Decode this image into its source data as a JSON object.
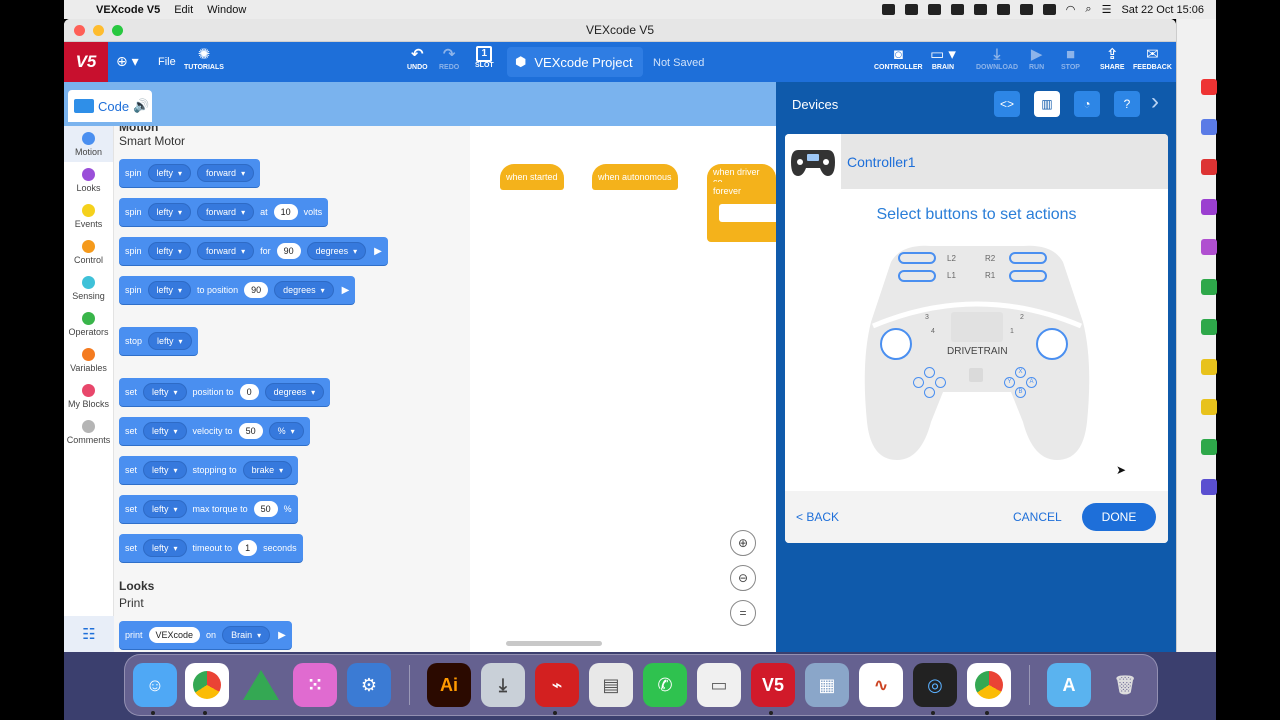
{
  "menubar": {
    "app_name": "VEXcode V5",
    "items": [
      "Edit",
      "Window"
    ],
    "clock": "Sat 22 Oct  15:06"
  },
  "window": {
    "title": "VEXcode V5"
  },
  "toolbar": {
    "logo": "V5",
    "file_label": "File",
    "tutorials_label": "TUTORIALS",
    "undo_label": "UNDO",
    "redo_label": "REDO",
    "slot_label": "SLOT",
    "slot_number": "1",
    "project_name": "VEXcode Project",
    "save_status": "Not Saved",
    "controller_label": "CONTROLLER",
    "brain_label": "BRAIN",
    "download_label": "DOWNLOAD",
    "run_label": "RUN",
    "stop_label": "STOP",
    "share_label": "SHARE",
    "feedback_label": "FEEDBACK"
  },
  "code_tab": {
    "label": "Code"
  },
  "categories": [
    {
      "label": "Motion",
      "color": "#4a8ff0"
    },
    {
      "label": "Looks",
      "color": "#9a4fd9"
    },
    {
      "label": "Events",
      "color": "#f5d11c"
    },
    {
      "label": "Control",
      "color": "#f59a1c"
    },
    {
      "label": "Sensing",
      "color": "#3fc1d8"
    },
    {
      "label": "Operators",
      "color": "#39b54a"
    },
    {
      "label": "Variables",
      "color": "#f47b20"
    },
    {
      "label": "My Blocks",
      "color": "#e8476b"
    },
    {
      "label": "Comments",
      "color": "#b5b5b5"
    }
  ],
  "palette": {
    "cut_header": "Motion",
    "section_smart_motor": "Smart Motor",
    "blocks": {
      "b1": {
        "w1": "spin",
        "d1": "lefty",
        "d2": "forward"
      },
      "b2": {
        "w1": "spin",
        "d1": "lefty",
        "d2": "forward",
        "w2": "at",
        "n1": "10",
        "w3": "volts"
      },
      "b3": {
        "w1": "spin",
        "d1": "lefty",
        "d2": "forward",
        "w2": "for",
        "n1": "90",
        "d3": "degrees"
      },
      "b4": {
        "w1": "spin",
        "d1": "lefty",
        "w2": "to position",
        "n1": "90",
        "d2": "degrees"
      },
      "b5": {
        "w1": "stop",
        "d1": "lefty"
      },
      "b6": {
        "w1": "set",
        "d1": "lefty",
        "w2": "position to",
        "n1": "0",
        "d2": "degrees"
      },
      "b7": {
        "w1": "set",
        "d1": "lefty",
        "w2": "velocity to",
        "n1": "50",
        "d2": "%"
      },
      "b8": {
        "w1": "set",
        "d1": "lefty",
        "w2": "stopping to",
        "d2": "brake"
      },
      "b9": {
        "w1": "set",
        "d1": "lefty",
        "w2": "max torque to",
        "n1": "50",
        "w3": "%"
      },
      "b10": {
        "w1": "set",
        "d1": "lefty",
        "w2": "timeout to",
        "n1": "1",
        "w3": "seconds"
      },
      "b11": {
        "w1": "print",
        "n1": "VEXcode",
        "w2": "on",
        "d1": "Brain"
      }
    },
    "section_looks": "Looks",
    "section_print": "Print"
  },
  "workspace": {
    "hat1": "when started",
    "hat2": "when autonomous",
    "hat3": "when driver co",
    "forever": "forever"
  },
  "devices": {
    "title": "Devices",
    "device_name": "Controller1",
    "instruction": "Select buttons to set actions",
    "controller": {
      "l2": "L2",
      "l1": "L1",
      "r2": "R2",
      "r1": "R1",
      "axis_3": "3",
      "axis_4": "4",
      "axis_2": "2",
      "axis_1": "1",
      "center": "DRIVETRAIN",
      "x": "X",
      "y": "Y",
      "a": "A",
      "b": "B"
    },
    "back_label": "< BACK",
    "cancel_label": "CANCEL",
    "done_label": "DONE"
  }
}
